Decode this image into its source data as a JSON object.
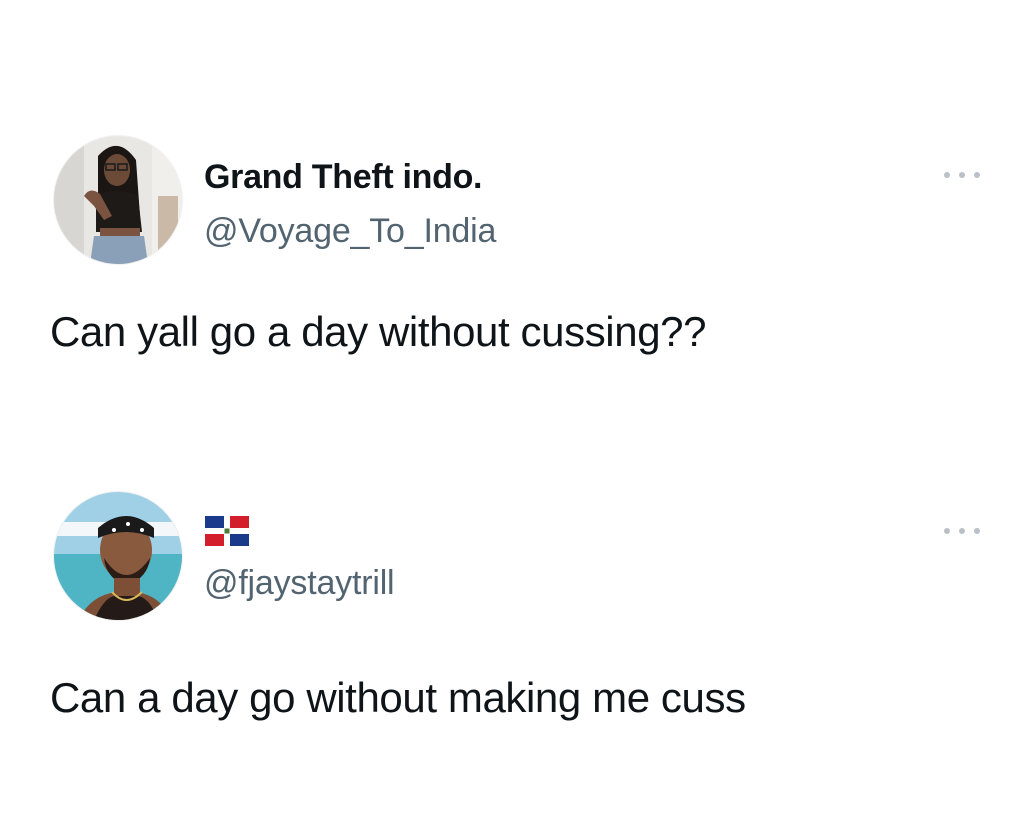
{
  "tweets": [
    {
      "display_name": "Grand Theft indo.",
      "handle": "@Voyage_To_India",
      "text": "Can yall go a day without cussing??"
    },
    {
      "display_name_icon": "dominican-republic-flag-icon",
      "handle": "@fjaystaytrill",
      "text": "Can a day go without making me cuss"
    }
  ],
  "colors": {
    "text": "#0f1419",
    "secondary_text": "#536471",
    "more_dots": "#b9c0c7",
    "background": "#ffffff"
  }
}
